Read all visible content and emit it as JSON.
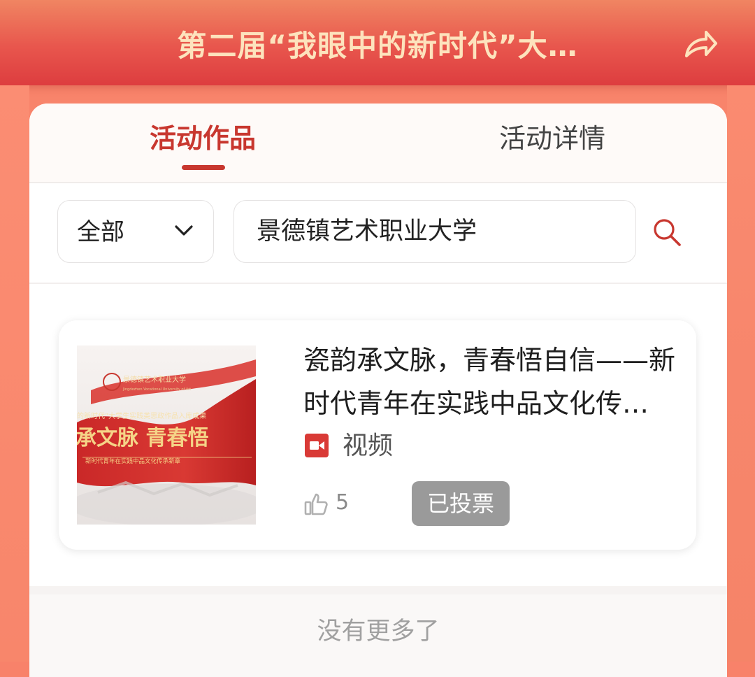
{
  "header": {
    "title": "第二届“我眼中的新时代”大…",
    "share_icon": "share-arrow-icon"
  },
  "tabs": [
    {
      "label": "活动作品",
      "active": true
    },
    {
      "label": "活动详情",
      "active": false
    }
  ],
  "filter": {
    "select_value": "全部",
    "search_value": "景德镇艺术职业大学"
  },
  "works": [
    {
      "title": "瓷韵承文脉，青春悟自信——新时代青年在实践中品文化传…",
      "type": "视频",
      "type_icon": "video-icon",
      "votes": "5",
      "vote_button": "已投票",
      "thumbnail": {
        "school_name_text": "景德镇艺术职业大学",
        "school_english": "Jingdezhen Vocational University of Art",
        "subtitle_text": "的新时代”大学生实践类思政作品入库成果",
        "main_text": "承文脉 青春悟",
        "sub_text": "新时代青年在实践中品文化传承新章"
      }
    }
  ],
  "footer": {
    "no_more": "没有更多了"
  },
  "colors": {
    "accent": "#c8372f",
    "header_text": "#fde3bd",
    "voted_button": "#9a9a9a"
  }
}
